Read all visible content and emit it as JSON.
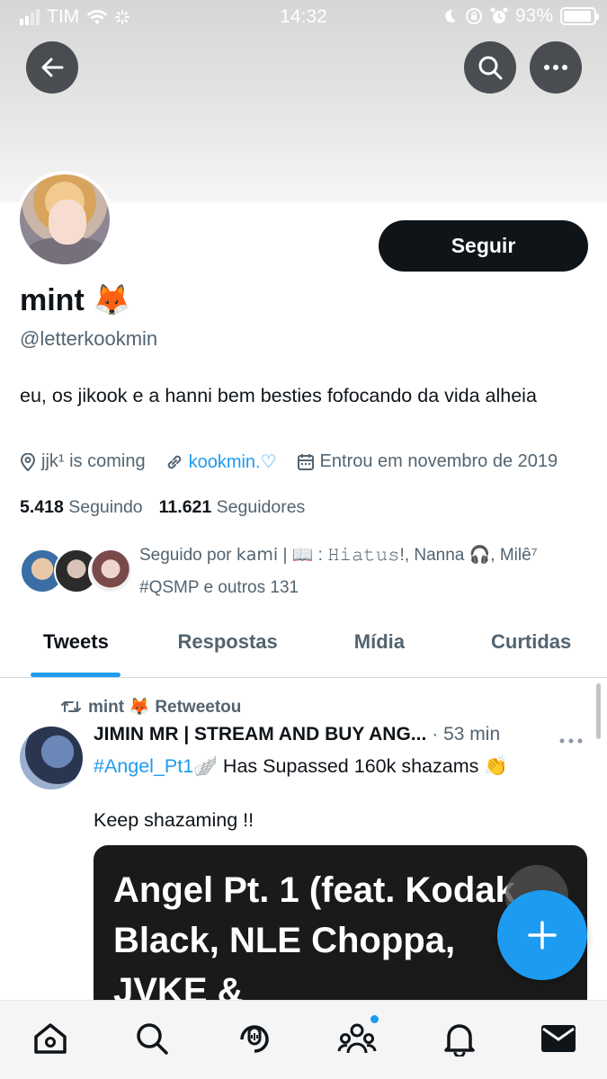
{
  "status_bar": {
    "carrier": "TIM",
    "time": "14:32",
    "battery": "93%",
    "battery_level": 0.93
  },
  "profile": {
    "follow_label": "Seguir",
    "name": "mint 🦊",
    "handle": "@letterkookmin",
    "bio": "eu, os jikook e a hanni bem besties fofocando da vida alheia",
    "location": "jjk¹ is coming",
    "link": "kookmin.♡",
    "joined": "Entrou em novembro de 2019",
    "following_count": "5.418",
    "following_label": "Seguindo",
    "followers_count": "11.621",
    "followers_label": "Seguidores",
    "followed_by_line1": "Seguido por 𝗄𝖺𝗆𝗂 | 📖 : 𝙷𝚒𝚊𝚝𝚞𝚜!, Nanna 🎧, Milê⁷",
    "followed_by_line2": "#QSMP e outros 131"
  },
  "tabs": [
    "Tweets",
    "Respostas",
    "Mídia",
    "Curtidas"
  ],
  "tweet": {
    "retweet_label": "mint 🦊 Retweetou",
    "author": "JIMIN MR | STREAM AND BUY ANG...",
    "time": "· 53 min",
    "hashtag": "#Angel_Pt1",
    "text_rest": "🪽 Has Supassed 160k shazams 👏",
    "text2": "Keep shazaming !!",
    "media_title": "Angel Pt. 1 (feat. Kodak Black, NLE Choppa, JVKE &"
  },
  "icons": {
    "back": "arrow-left-icon",
    "search": "search-icon",
    "more": "more-horizontal-icon",
    "fab": "plus-icon",
    "nav": [
      "home-icon",
      "search-icon",
      "spaces-icon",
      "communities-icon",
      "notifications-icon",
      "messages-icon"
    ]
  },
  "colors": {
    "accent": "#1d9bf0",
    "text": "#0f1419",
    "muted": "#536471"
  }
}
